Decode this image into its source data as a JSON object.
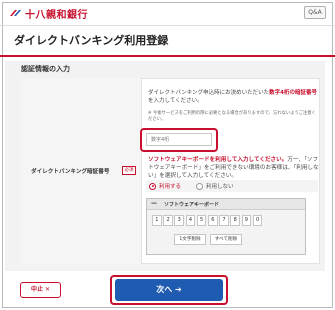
{
  "header": {
    "bank_name": "十八親和銀行",
    "qa_label": "Q&A"
  },
  "page": {
    "title": "ダイレクトバンキング利用登録",
    "section": "認証情報の入力"
  },
  "form": {
    "field_label": "ダイレクトバンキング暗証番号",
    "required_badge": "必須",
    "desc_1": "ダイレクトバンキング申込時にお決めいただいた",
    "desc_red": "数字4桁の暗証番号",
    "desc_2": "を入力してください。",
    "note": "※ 今後サービスをご利用の際に必要となる場合がありますので、忘れないようご注意ください。",
    "input_placeholder": "数字4桁",
    "sk_red": "ソフトウェアキーボードを利用して入力してください。",
    "sk_text": "万一、「ソフトウェアキーボード」をご利用できない環境のお客様は、「利用しない」を選択して入力してください。",
    "radio_use": "利用する",
    "radio_not_use": "利用しない"
  },
  "keyboard": {
    "title": "ソフトウェアキーボード",
    "minimize": "—",
    "keys": [
      "1",
      "2",
      "3",
      "4",
      "5",
      "6",
      "7",
      "8",
      "9",
      "0"
    ],
    "delete_one": "1文字削除",
    "delete_all": "すべて削除"
  },
  "actions": {
    "stop": "中止 ✕",
    "next": "次へ ➔"
  },
  "colors": {
    "brand_red": "#c8102e",
    "primary_blue": "#1f5bb0"
  }
}
